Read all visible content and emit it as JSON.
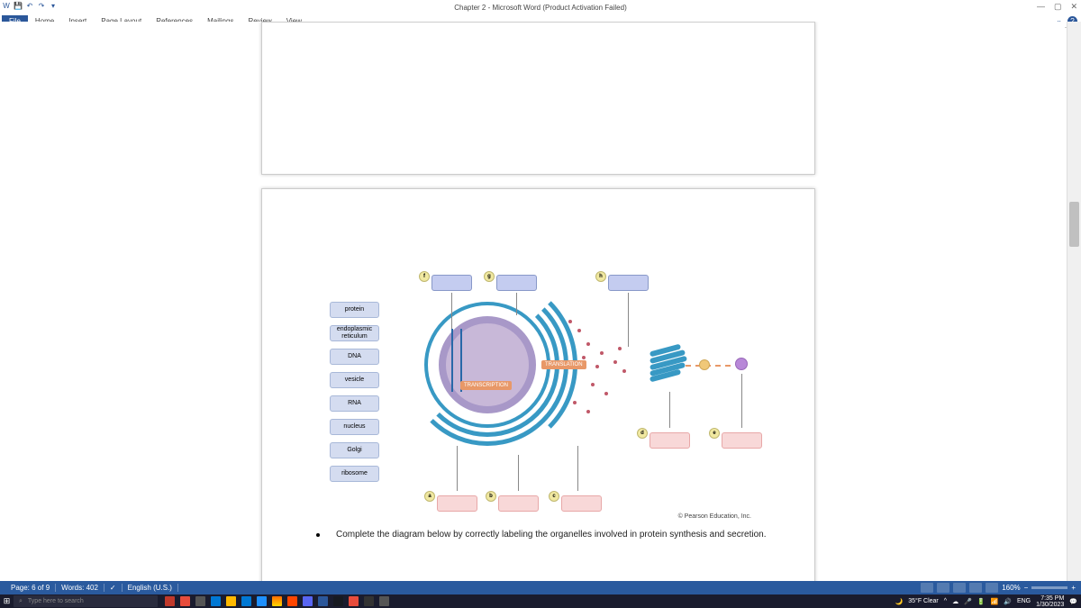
{
  "title": "Chapter 2 - Microsoft Word (Product Activation Failed)",
  "ribbon": {
    "tabs": [
      "File",
      "Home",
      "Insert",
      "Page Layout",
      "References",
      "Mailings",
      "Review",
      "View"
    ]
  },
  "labels": {
    "protein": "protein",
    "er": "endoplasmic reticulum",
    "dna": "DNA",
    "vesicle": "vesicle",
    "rna": "RNA",
    "nucleus": "nucleus",
    "golgi": "Golgi",
    "ribosome": "ribosome"
  },
  "process": {
    "transcription": "TRANSCRIPTION",
    "translation": "TRANSLATION"
  },
  "letters": {
    "a": "a",
    "b": "b",
    "c": "c",
    "d": "d",
    "e": "e",
    "f": "f",
    "g": "g",
    "h": "h"
  },
  "copyright": "© Pearson Education, Inc.",
  "instruction": "Complete the diagram below by correctly labeling the organelles involved in protein synthesis and secretion.",
  "status": {
    "page": "Page: 6 of 9",
    "words": "Words: 402",
    "lang": "English (U.S.)",
    "zoom": "160%"
  },
  "taskbar": {
    "search_placeholder": "Type here to search",
    "weather": "35°F Clear",
    "lang": "ENG",
    "time": "7:35 PM",
    "date": "1/30/2023"
  }
}
